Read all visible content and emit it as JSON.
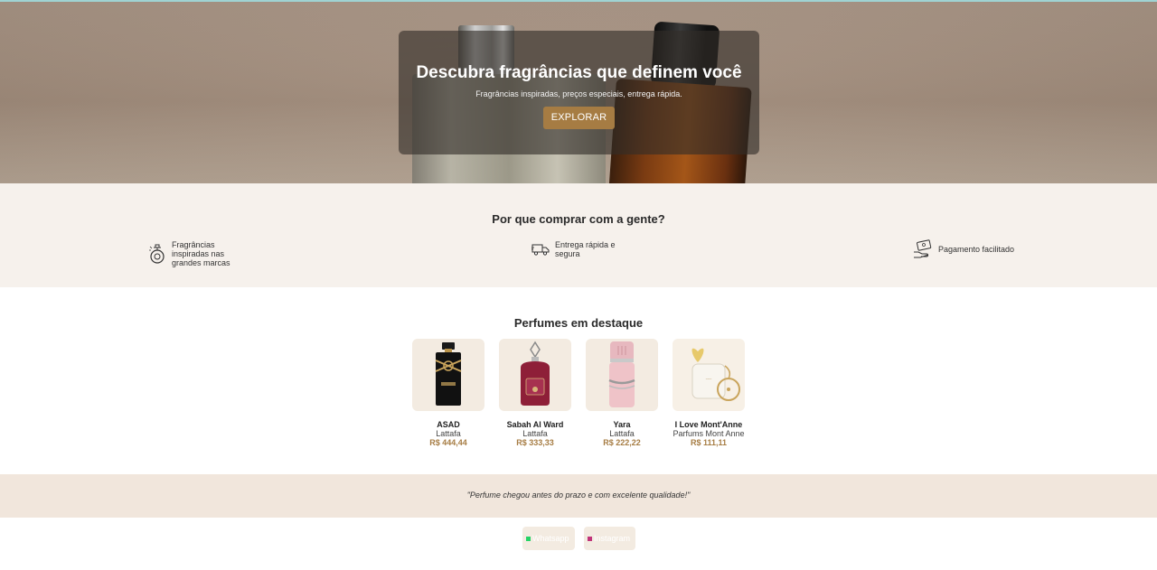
{
  "hero": {
    "title": "Descubra fragrâncias que definem você",
    "subtitle": "Fragrâncias inspiradas, preços especiais, entrega rápida.",
    "cta_label": "EXPLORAR"
  },
  "why": {
    "title": "Por que comprar com a gente?",
    "features": [
      {
        "icon": "perfume-icon",
        "text": "Fragrâncias inspiradas nas grandes marcas"
      },
      {
        "icon": "delivery-truck-icon",
        "text": "Entrega rápida e segura"
      },
      {
        "icon": "payment-hand-icon",
        "text": "Pagamento facilitado"
      }
    ]
  },
  "featured": {
    "title": "Perfumes em destaque",
    "products": [
      {
        "name": "ASAD",
        "brand": "Lattafa",
        "price": "R$ 444,44"
      },
      {
        "name": "Sabah Al Ward",
        "brand": "Lattafa",
        "price": "R$ 333,33"
      },
      {
        "name": "Yara",
        "brand": "Lattafa",
        "price": "R$ 222,22"
      },
      {
        "name": "I Love Mont'Anne",
        "brand": "Parfums Mont Anne",
        "price": "R$ 111,11"
      }
    ]
  },
  "testimonial": {
    "quote": "\"Perfume chegou antes do prazo e com excelente qualidade!\""
  },
  "social": {
    "whatsapp_label": "Whatsapp",
    "instagram_label": "Instagram"
  },
  "colors": {
    "accent": "#a67c43",
    "section_bg": "#f6f1ec",
    "testimonial_bg": "#f1e6dc"
  }
}
